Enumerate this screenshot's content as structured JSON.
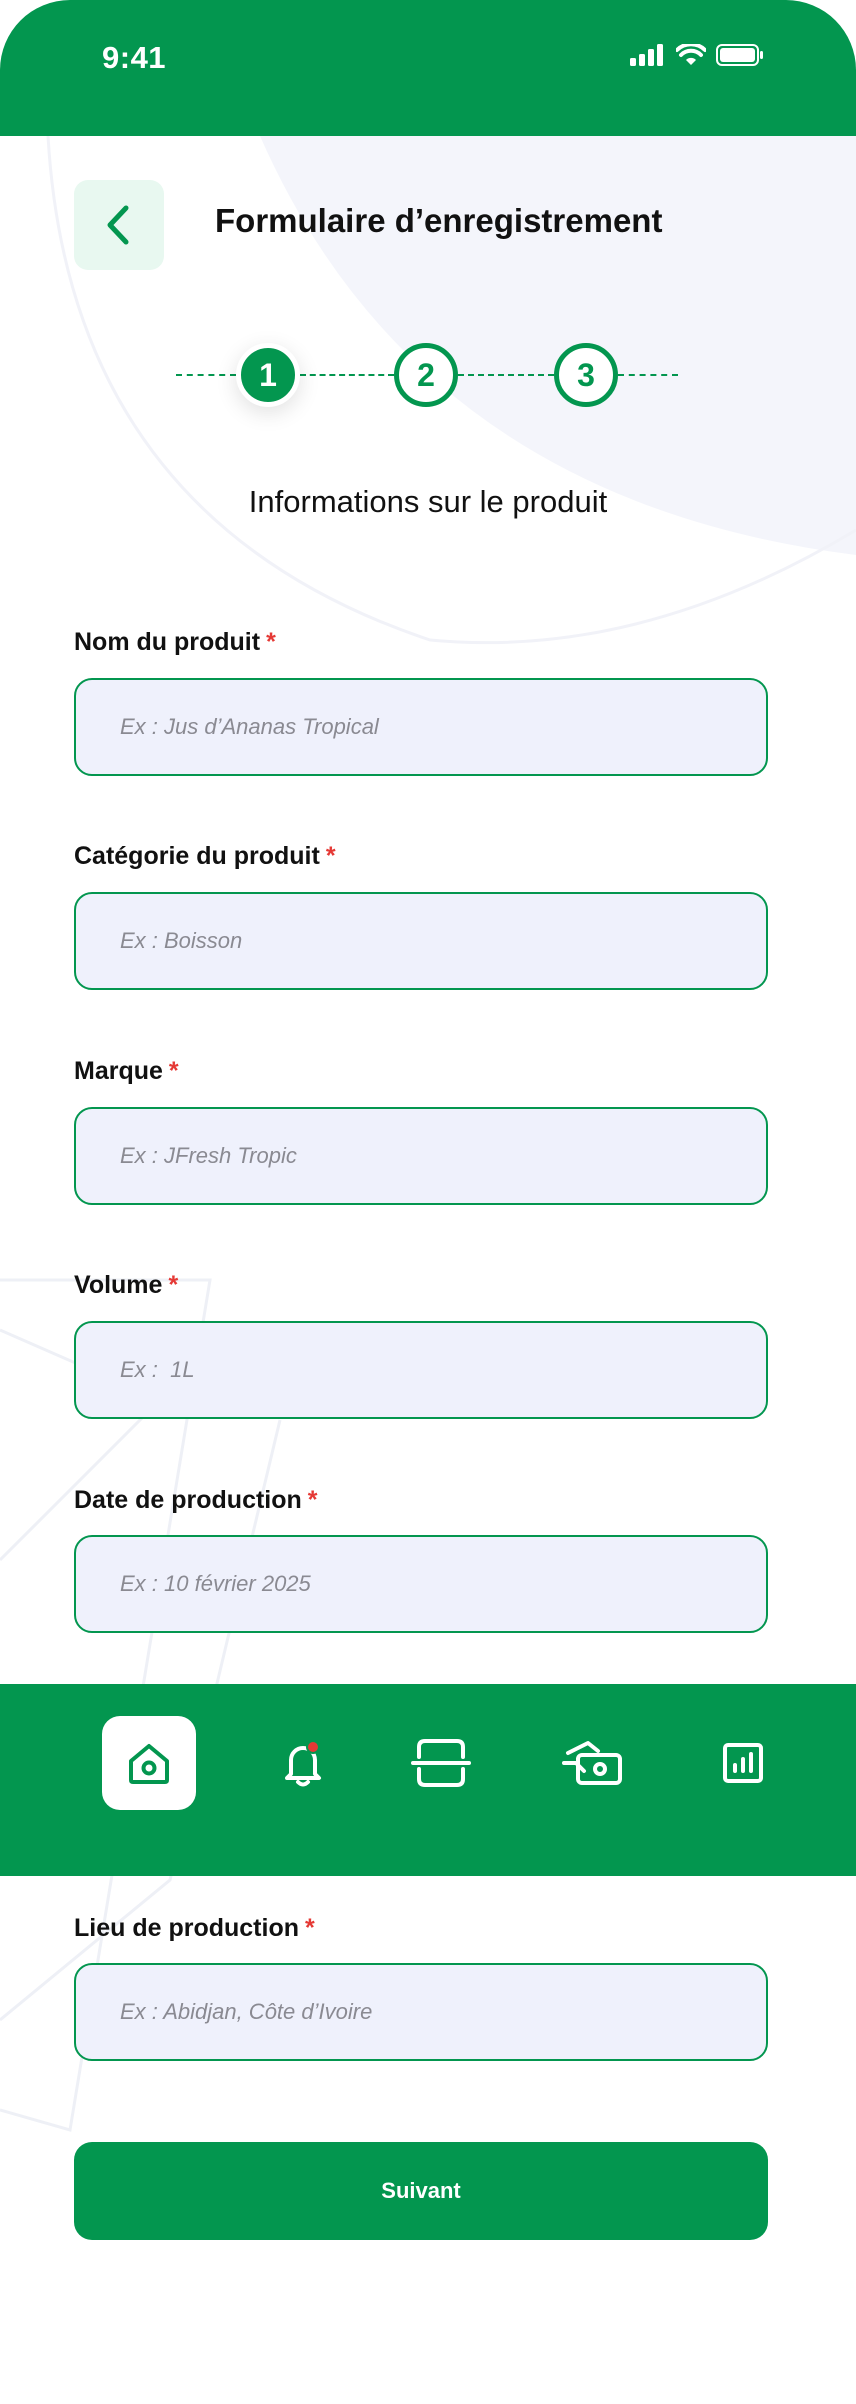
{
  "status_bar": {
    "time": "9:41"
  },
  "header": {
    "title": "Formulaire d’enregistrement"
  },
  "stepper": {
    "steps": [
      "1",
      "2",
      "3"
    ],
    "current": 1
  },
  "section_title": "Informations sur le produit",
  "form": {
    "required_mark": "*",
    "fields": [
      {
        "label": "Nom du produit",
        "placeholder": "Ex : Jus d’Ananas Tropical",
        "value": ""
      },
      {
        "label": "Catégorie du produit",
        "placeholder": "Ex : Boisson",
        "value": ""
      },
      {
        "label": "Marque",
        "placeholder": "Ex : JFresh Tropic",
        "value": ""
      },
      {
        "label": "Volume",
        "placeholder": "Ex :  1L",
        "value": ""
      },
      {
        "label": "Date de production",
        "placeholder": "Ex : 10 février 2025",
        "value": ""
      },
      {
        "label": "Lieu de production",
        "placeholder": "Ex : Abidjan, Côte d’Ivoire",
        "value": ""
      }
    ]
  },
  "bottom_nav": {
    "items": [
      {
        "icon": "home-icon",
        "active": true
      },
      {
        "icon": "bell-icon",
        "active": false,
        "badge": true
      },
      {
        "icon": "scan-icon",
        "active": false
      },
      {
        "icon": "cash-icon",
        "active": false
      },
      {
        "icon": "stats-icon",
        "active": false
      }
    ]
  },
  "actions": {
    "next_label": "Suivant"
  },
  "colors": {
    "primary": "#03964F",
    "input_bg": "#EFF1FC",
    "required": "#E53935",
    "back_bg": "#E8F8F0"
  }
}
